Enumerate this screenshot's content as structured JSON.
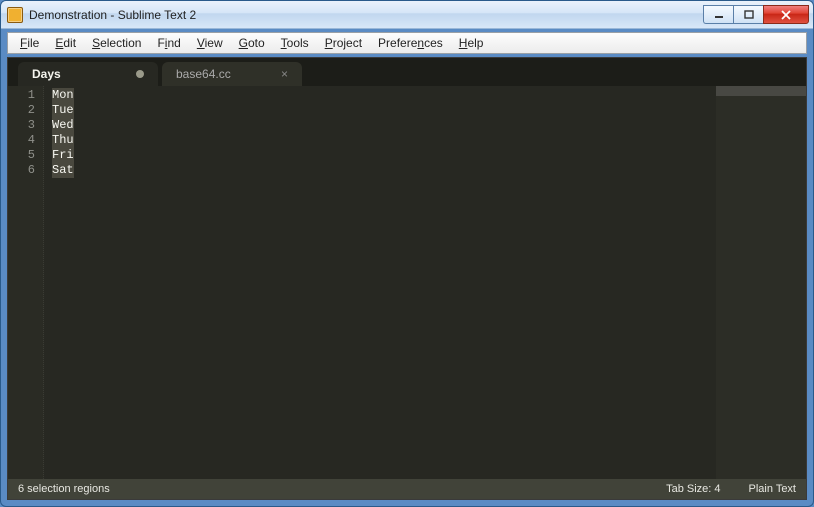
{
  "window": {
    "title": "Demonstration - Sublime Text 2"
  },
  "menu": {
    "items": [
      {
        "label": "File",
        "u": "F"
      },
      {
        "label": "Edit",
        "u": "E"
      },
      {
        "label": "Selection",
        "u": "S"
      },
      {
        "label": "Find",
        "u": "i"
      },
      {
        "label": "View",
        "u": "V"
      },
      {
        "label": "Goto",
        "u": "G"
      },
      {
        "label": "Tools",
        "u": "T"
      },
      {
        "label": "Project",
        "u": "P"
      },
      {
        "label": "Preferences",
        "u": "n"
      },
      {
        "label": "Help",
        "u": "H"
      }
    ]
  },
  "tabs": {
    "active": {
      "label": "Days",
      "dirty": true
    },
    "inactive": {
      "label": "base64.cc"
    }
  },
  "editor": {
    "lines": [
      "Mon",
      "Tue",
      "Wed",
      "Thu",
      "Fri",
      "Sat"
    ],
    "line_numbers": [
      "1",
      "2",
      "3",
      "4",
      "5",
      "6"
    ]
  },
  "status": {
    "left": "6 selection regions",
    "tabsize": "Tab Size: 4",
    "syntax": "Plain Text"
  }
}
